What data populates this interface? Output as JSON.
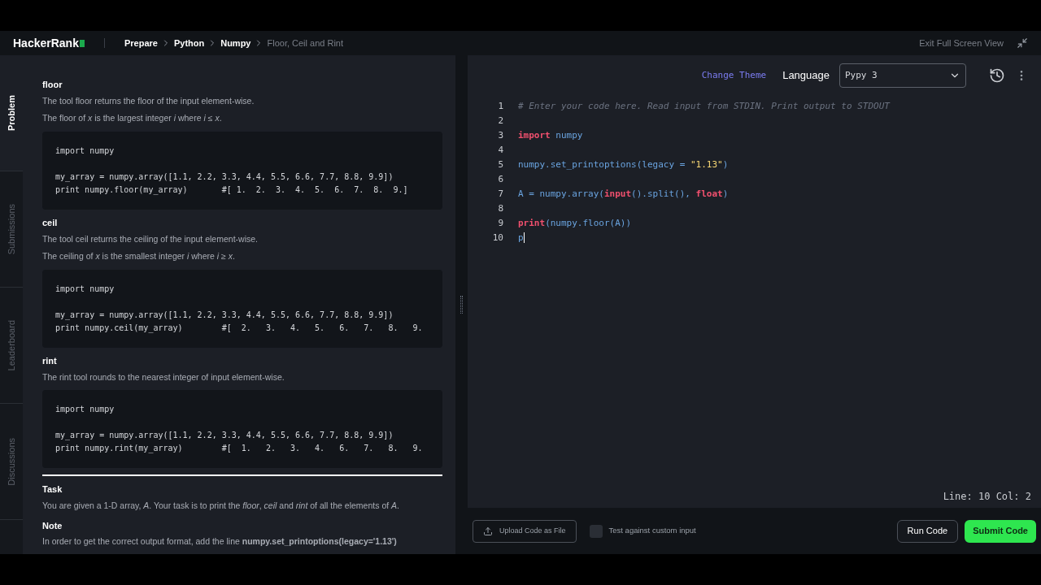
{
  "header": {
    "logo": "HackerRank",
    "breadcrumbs": [
      {
        "label": "Prepare",
        "current": false
      },
      {
        "label": "Python",
        "current": false
      },
      {
        "label": "Numpy",
        "current": false
      },
      {
        "label": "Floor, Ceil and Rint",
        "current": true
      }
    ],
    "exit_label": "Exit Full Screen View"
  },
  "side_tabs": [
    {
      "label": "Problem",
      "selected": true
    },
    {
      "label": "Submissions",
      "selected": false
    },
    {
      "label": "Leaderboard",
      "selected": false
    },
    {
      "label": "Discussions",
      "selected": false
    }
  ],
  "sections": [
    {
      "kind": "heading",
      "text": "floor"
    },
    {
      "kind": "paragraph",
      "text": "The tool floor returns the floor of the input element-wise."
    },
    {
      "kind": "paragraph",
      "text": "The floor of *x* is the largest integer *i* where *i* ≤ *x*."
    },
    {
      "kind": "code",
      "groups": [
        [
          "import numpy"
        ],
        [
          "my_array = numpy.array([1.1, 2.2, 3.3, 4.4, 5.5, 6.6, 7.7, 8.8, 9.9])",
          "print numpy.floor(my_array)       #[ 1.  2.  3.  4.  5.  6.  7.  8.  9.]"
        ]
      ]
    },
    {
      "kind": "heading",
      "text": "ceil"
    },
    {
      "kind": "paragraph",
      "text": "The tool ceil returns the ceiling of the input element-wise."
    },
    {
      "kind": "paragraph",
      "text": "The ceiling of *x* is the smallest integer *i* where *i* ≥ *x*."
    },
    {
      "kind": "code",
      "groups": [
        [
          "import numpy"
        ],
        [
          "my_array = numpy.array([1.1, 2.2, 3.3, 4.4, 5.5, 6.6, 7.7, 8.8, 9.9])",
          "print numpy.ceil(my_array)        #[  2.   3.   4.   5.   6.   7.   8.   9."
        ]
      ]
    },
    {
      "kind": "heading",
      "text": "rint"
    },
    {
      "kind": "paragraph",
      "text": "The rint tool rounds to the nearest integer of input element-wise."
    },
    {
      "kind": "code",
      "groups": [
        [
          "import numpy"
        ],
        [
          "my_array = numpy.array([1.1, 2.2, 3.3, 4.4, 5.5, 6.6, 7.7, 8.8, 9.9])",
          "print numpy.rint(my_array)        #[  1.   2.   3.   4.   6.   7.   8.   9."
        ]
      ]
    },
    {
      "kind": "rule"
    },
    {
      "kind": "heading",
      "text": "Task"
    },
    {
      "kind": "paragraph",
      "text": "You are given a 1-D array, *A*. Your task is to print the *floor*, *ceil* and *rint* of all the elements of *A*."
    },
    {
      "kind": "heading",
      "text": "Note"
    },
    {
      "kind": "paragraph",
      "text": "In order to get the correct output format, add the line **numpy.set_printoptions(legacy='1.13')**"
    }
  ],
  "editor": {
    "change_theme": "Change Theme",
    "language_label": "Language",
    "language": "Pypy 3",
    "lines": [
      {
        "number": "1",
        "tokens": [
          {
            "kind": "comment",
            "text": "# Enter your code here. Read input from STDIN. Print output to STDOUT"
          }
        ]
      },
      {
        "number": "2"
      },
      {
        "number": "3",
        "tokens": [
          {
            "kind": "keyword",
            "text": "import"
          },
          {
            "kind": "plain",
            "text": " numpy"
          }
        ]
      },
      {
        "number": "4"
      },
      {
        "number": "5",
        "tokens": [
          {
            "kind": "plain",
            "text": "numpy.set_printoptions(legacy = "
          },
          {
            "kind": "string",
            "text": "\"1.13\""
          },
          {
            "kind": "plain",
            "text": ")"
          }
        ]
      },
      {
        "number": "6"
      },
      {
        "number": "7",
        "tokens": [
          {
            "kind": "plain",
            "text": "A = numpy.array("
          },
          {
            "kind": "keyword",
            "text": "input"
          },
          {
            "kind": "plain",
            "text": "().split(), "
          },
          {
            "kind": "keyword",
            "text": "float"
          },
          {
            "kind": "plain",
            "text": ")"
          }
        ]
      },
      {
        "number": "8"
      },
      {
        "number": "9",
        "tokens": [
          {
            "kind": "keyword",
            "text": "print"
          },
          {
            "kind": "plain",
            "text": "(numpy.floor(A))"
          }
        ]
      },
      {
        "number": "10",
        "tokens": [
          {
            "kind": "plain",
            "text": "p"
          }
        ]
      }
    ],
    "status": "Line: 10 Col: 2"
  },
  "footer": {
    "upload": "Upload Code as File",
    "custom_input": {
      "label": "Test against custom input",
      "checked": false
    },
    "run": "Run Code",
    "submit": "Submit Code"
  }
}
